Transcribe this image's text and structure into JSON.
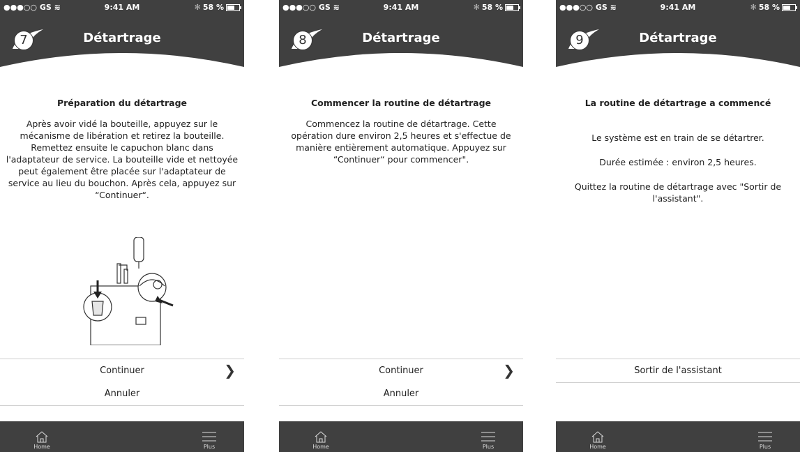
{
  "status_bar": {
    "carrier": "●●●○○ GS ",
    "wifi": "wifi-icon",
    "time": "9:41 AM",
    "bluetooth": "✻",
    "battery": "58 %",
    "battery_level_percent": 58
  },
  "screens": [
    {
      "step": "7",
      "title": "Détartrage",
      "heading": "Préparation du détartrage",
      "paragraphs": [
        "Après avoir vidé la bouteille, appuyez sur le mécanisme de libération et retirez la bouteille. Remettez ensuite le capuchon blanc dans l'adaptateur de service. La bouteille vide et nettoyée peut également être placée sur l'adaptateur de service au lieu du bouchon. Après cela, appuyez sur “Continuer“."
      ],
      "buttons": [
        "Continuer",
        "Annuler"
      ],
      "tabs": {
        "home": "Home",
        "plus": "Plus"
      }
    },
    {
      "step": "8",
      "title": "Détartrage",
      "heading": "Commencer la routine de détartrage",
      "paragraphs": [
        "Commencez la routine de détartrage. Cette opération dure environ 2,5 heures et s'effectue de manière entièrement automatique. Appuyez sur “Continuer“ pour commencer\"."
      ],
      "buttons": [
        "Continuer",
        "Annuler"
      ],
      "tabs": {
        "home": "Home",
        "plus": "Plus"
      }
    },
    {
      "step": "9",
      "title": "Détartrage",
      "heading": "La routine de détartrage a commencé",
      "paragraphs": [
        "Le système est en train de se détartrer.",
        "Durée estimée : environ 2,5 heures.",
        "Quittez la routine de détartrage avec \"Sortir de l'assistant\"."
      ],
      "buttons": [
        "Sortir de l'assistant"
      ],
      "tabs": {
        "home": "Home",
        "plus": "Plus"
      }
    }
  ],
  "colors": {
    "header": "#404040",
    "tabbar": "#404040",
    "text": "#222222",
    "divider": "#cfcfcf"
  }
}
